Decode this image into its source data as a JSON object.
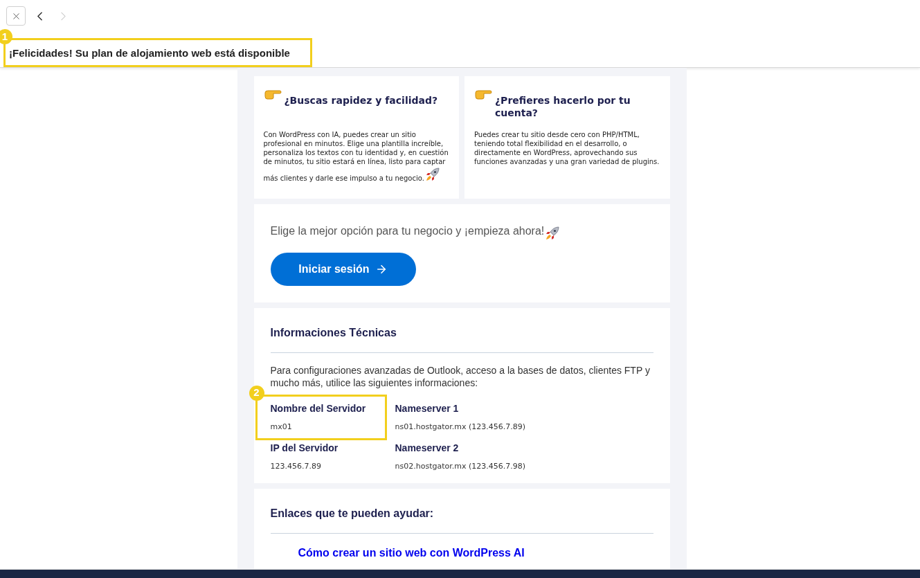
{
  "nav": [
    {
      "kind": "back",
      "disabled": false
    },
    {
      "kind": "forward",
      "disabled": true
    }
  ],
  "subject": {
    "text": "¡Felicidades! Su plan de alojamiento web está disponible",
    "callout": "1"
  },
  "options": [
    {
      "title": "¿Buscas rapidez y facilidad?",
      "body": "Con WordPress con IA, puedes crear un sitio profesional en minutos. Elige una plantilla increíble, personaliza los textos con tu identidad y, en cuestión de minutos, tu sitio estará en línea, listo para captar más clientes y darle ese impulso a tu negocio.",
      "rocket": true
    },
    {
      "title": "¿Prefieres hacerlo por tu cuenta?",
      "body": "Puedes crear tu sitio desde cero con PHP/HTML, teniendo total flexibilidad en el desarrollo, o directamente en WordPress, aprovechando sus funciones avanzadas y una gran variedad de plugins.",
      "rocket": false
    }
  ],
  "cta": {
    "text": "Elige la mejor opción para tu negocio y ¡empieza ahora!",
    "button": "Iniciar sesión"
  },
  "tech": {
    "title": "Informaciones Técnicas",
    "intro": "Para configuraciones avanzadas de Outlook, acceso a la bases de datos, clientes FTP y mucho más, utilice las siguientes informaciones:",
    "fields": [
      {
        "label": "Nombre del Servidor",
        "value": "mx01",
        "callout": "2"
      },
      {
        "label": "Nameserver 1",
        "value": "ns01.hostgator.mx (123.456.7.89)"
      },
      {
        "label": "IP del Servidor",
        "value": "123.456.7.89"
      },
      {
        "label": "Nameserver 2",
        "value": "ns02.hostgator.mx (123.456.7.98)"
      }
    ]
  },
  "links": {
    "title": "Enlaces que te pueden ayudar:",
    "items": [
      "Cómo crear un sitio web con WordPress AI"
    ]
  }
}
